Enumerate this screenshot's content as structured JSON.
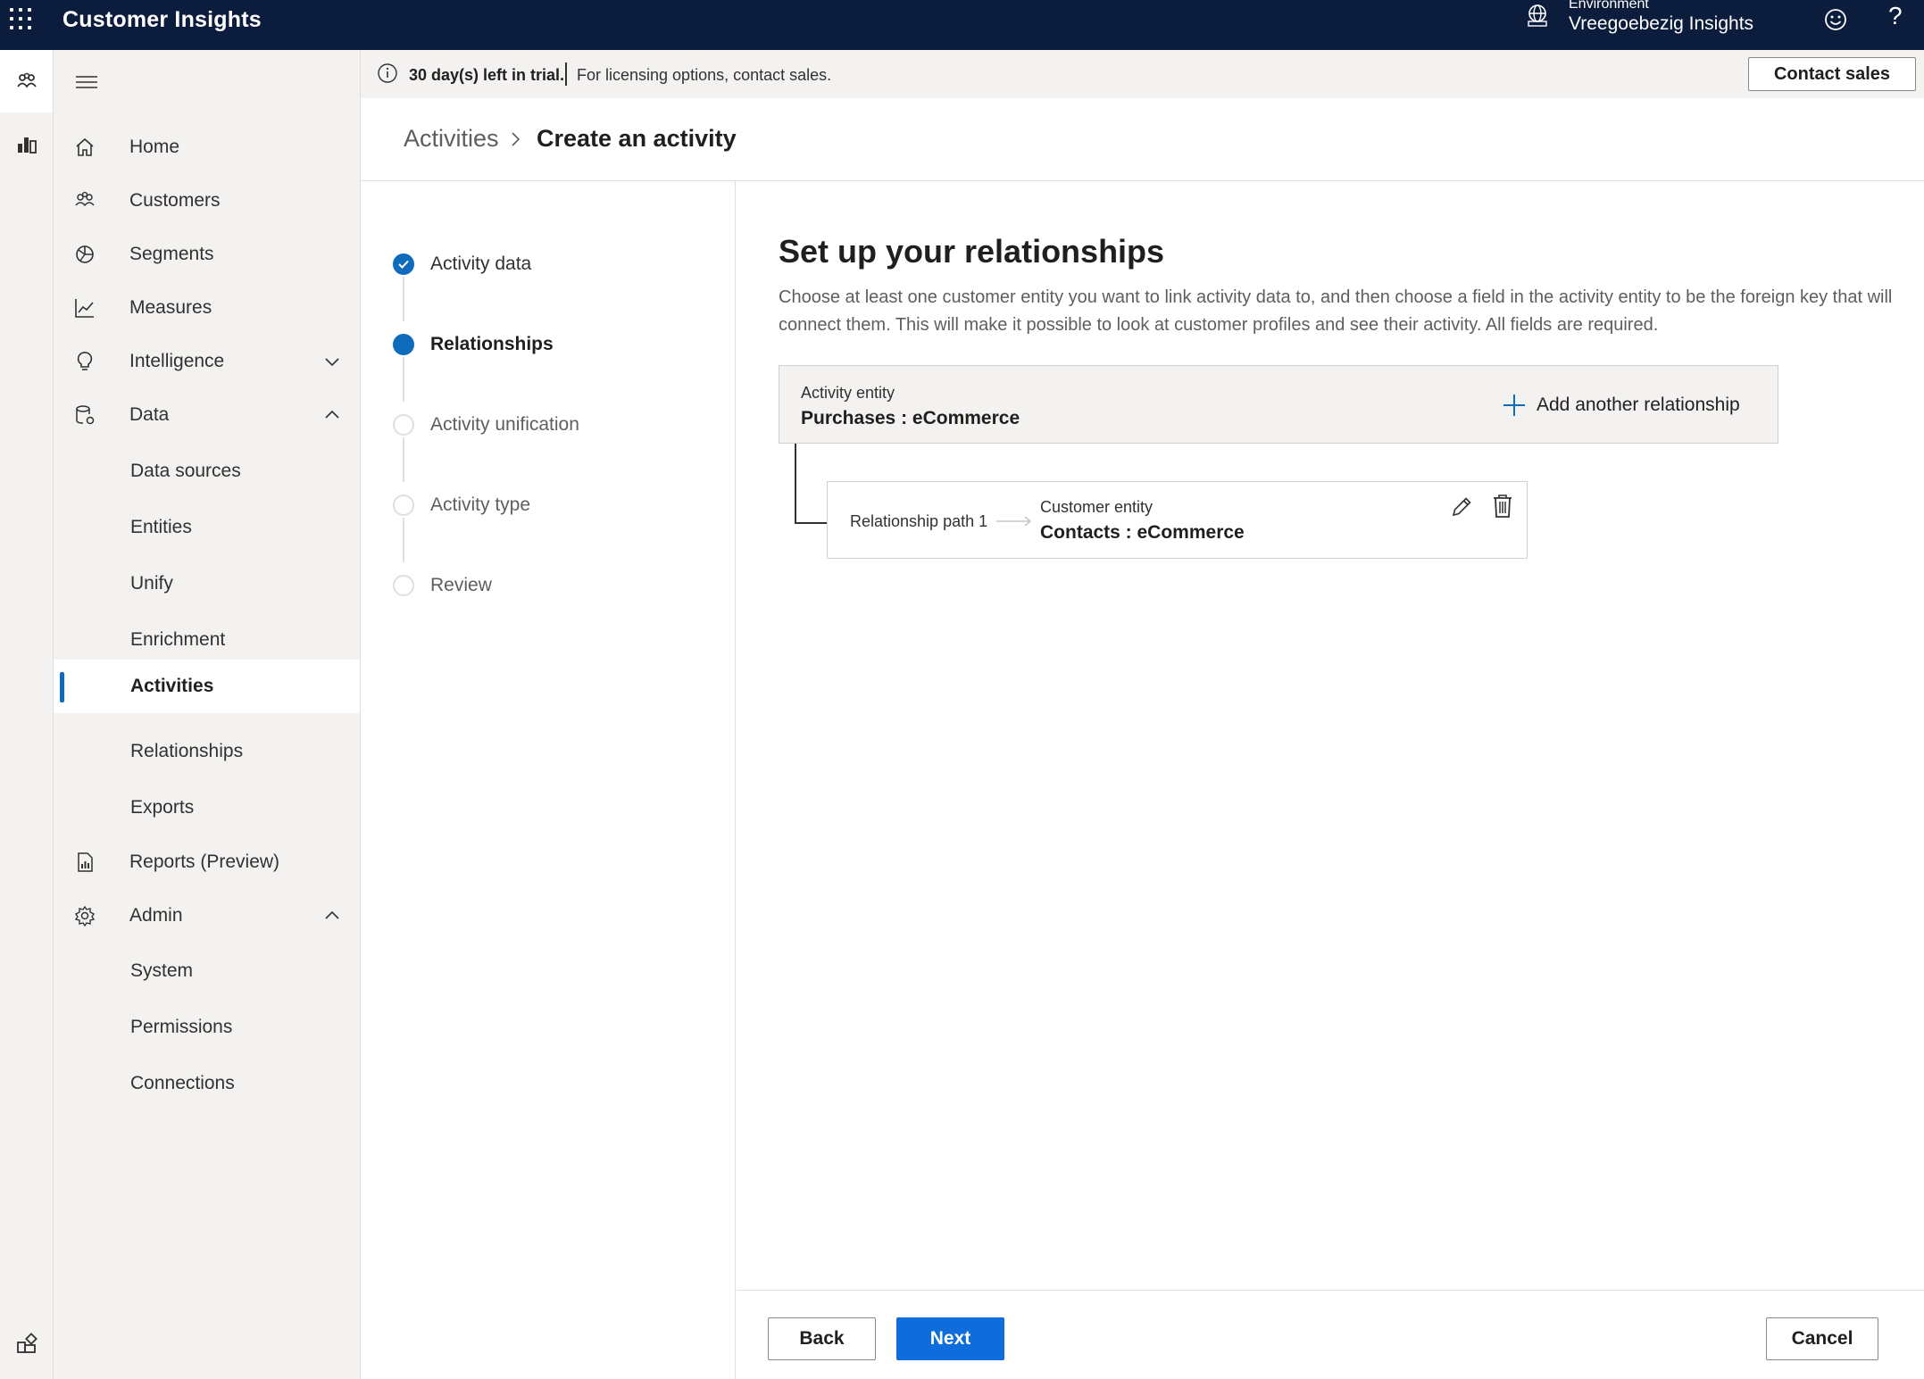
{
  "topbar": {
    "app_title": "Customer Insights",
    "environment_label": "Environment",
    "environment_name": "Vreegoebezig Insights",
    "icons": [
      "waffle-icon",
      "globe-icon",
      "smile-icon",
      "help-icon"
    ],
    "help_glyph": "?"
  },
  "rail": {
    "items": [
      "people-icon",
      "dashboard-icon"
    ],
    "bottom_icon": "app-settings-icon"
  },
  "nav": {
    "items": [
      {
        "label": "Home",
        "icon": "home-icon"
      },
      {
        "label": "Customers",
        "icon": "customers-icon"
      },
      {
        "label": "Segments",
        "icon": "segments-icon"
      },
      {
        "label": "Measures",
        "icon": "measures-icon"
      },
      {
        "label": "Intelligence",
        "icon": "lightbulb-icon"
      },
      {
        "label": "Data",
        "icon": "data-icon"
      },
      {
        "label": "Data sources"
      },
      {
        "label": "Entities"
      },
      {
        "label": "Unify"
      },
      {
        "label": "Enrichment"
      },
      {
        "label": "Activities"
      },
      {
        "label": "Relationships"
      },
      {
        "label": "Exports"
      },
      {
        "label": "Reports (Preview)",
        "icon": "report-icon"
      },
      {
        "label": "Admin",
        "icon": "gear-icon"
      },
      {
        "label": "System"
      },
      {
        "label": "Permissions"
      },
      {
        "label": "Connections"
      }
    ],
    "selected": "Activities"
  },
  "banner": {
    "trial_text": "30 day(s) left in trial.",
    "licensing_text": "For licensing options, contact sales.",
    "contact_label": "Contact sales"
  },
  "breadcrumb": {
    "parent": "Activities",
    "current": "Create an activity"
  },
  "stepper": {
    "steps": [
      {
        "label": "Activity data",
        "state": "done"
      },
      {
        "label": "Relationships",
        "state": "current"
      },
      {
        "label": "Activity unification",
        "state": "pending"
      },
      {
        "label": "Activity type",
        "state": "pending"
      },
      {
        "label": "Review",
        "state": "pending"
      }
    ]
  },
  "main": {
    "title": "Set up your relationships",
    "description": "Choose at least one customer entity you want to link activity data to, and then choose a field in the activity entity to be the foreign key that will connect them. This will make it possible to look at customer profiles and see their activity. All fields are required.",
    "activity_entity_label": "Activity entity",
    "activity_entity_value": "Purchases : eCommerce",
    "add_relationship_label": "Add another relationship",
    "relationship": {
      "path_label": "Relationship path 1",
      "customer_entity_label": "Customer entity",
      "customer_entity_value": "Contacts : eCommerce"
    }
  },
  "footer": {
    "back_label": "Back",
    "next_label": "Next",
    "cancel_label": "Cancel"
  },
  "colors": {
    "topbar": "#0c1c3c",
    "accent": "#0f6cbd",
    "primary_button": "#0f6cdb",
    "nav_background": "#f3f2f1"
  }
}
